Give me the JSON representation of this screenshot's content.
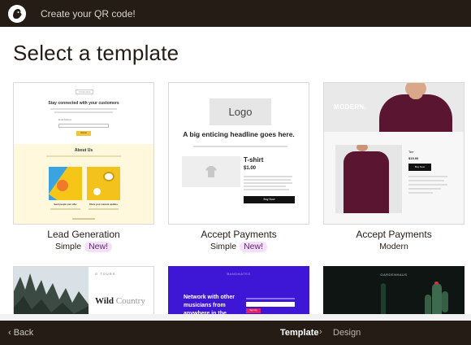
{
  "header": {
    "title": "Create your QR code!",
    "logo_icon": "mailchimp-freddie-icon"
  },
  "page": {
    "title": "Select a template"
  },
  "cards": [
    {
      "title": "Lead Generation",
      "subtitle": "Simple",
      "badge": "New!",
      "preview": {
        "logo": "YOUR LOGO",
        "heading": "Stay connected with your customers",
        "signup_label": "Email Address",
        "button": "Submit",
        "about": "About Us",
        "cap1": "Send people your offer",
        "cap2": "Share your relevant updates"
      }
    },
    {
      "title": "Accept Payments",
      "subtitle": "Simple",
      "badge": "New!",
      "preview": {
        "logo": "Logo",
        "headline": "A big enticing headline goes here.",
        "product": "T-shirt",
        "price": "$1.00",
        "button": "Buy Now"
      }
    },
    {
      "title": "Accept Payments",
      "subtitle": "Modern",
      "preview": {
        "brand": "MODERN.",
        "product": "Tee",
        "price": "$15.00",
        "button": "Buy Now"
      }
    },
    {
      "title": "",
      "preview": {
        "brand": "TOURS",
        "heading_a": "Wild",
        "heading_b": "Country"
      }
    },
    {
      "title": "",
      "preview": {
        "brand": "BANDMATES",
        "heading": "Network with other musicians from anywhere in the",
        "button": "Sign Up"
      }
    },
    {
      "title": "",
      "preview": {
        "brand": "GARDENHAUS"
      }
    }
  ],
  "footer": {
    "back_label": "Back",
    "back_icon": "chevron-left-icon",
    "step_current": "Template",
    "step_separator_icon": "chevron-right-icon",
    "step_next": "Design"
  },
  "colors": {
    "bar": "#241c15",
    "badge_bg": "#f4e0fb",
    "lead_yellow": "#fff8dc",
    "band_blue": "#3d16d6",
    "tee_maroon": "#5a1630"
  }
}
